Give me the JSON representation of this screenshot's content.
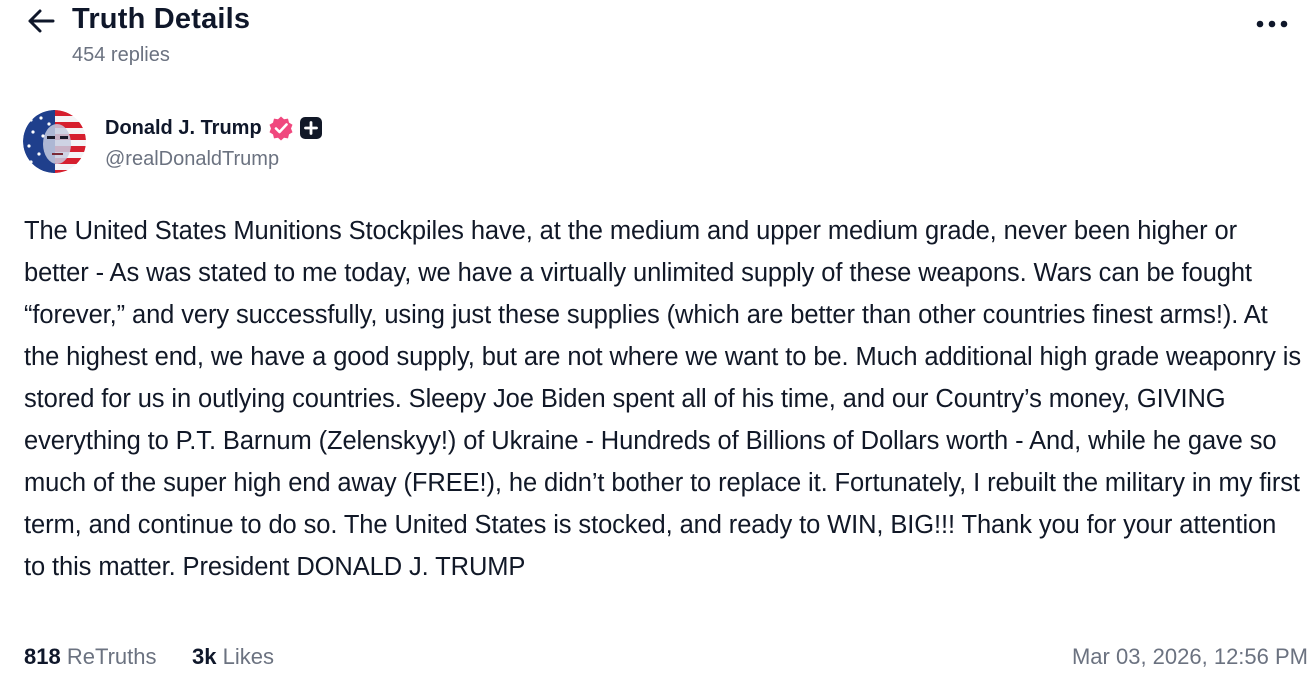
{
  "header": {
    "title": "Truth Details",
    "replies": "454 replies",
    "back_icon": "arrow-left-icon",
    "more_icon": "more-horizontal-icon"
  },
  "author": {
    "name": "Donald J. Trump",
    "handle": "@realDonaldTrump",
    "verified_icon": "verified-badge-icon",
    "plus_icon": "plus-badge-icon",
    "verified_color": "#f0487e"
  },
  "post": {
    "text": "The United States Munitions Stockpiles have, at the medium and upper medium grade, never been higher or better - As was stated to me today, we have a virtually unlimited supply of these weapons. Wars can be fought “forever,” and very successfully, using just these supplies (which are better than other countries finest arms!). At the highest end, we have a good supply, but are not where we want to be. Much additional high grade weaponry is stored for us in outlying countries. Sleepy Joe Biden spent all of his time, and our Country’s money, GIVING everything to P.T. Barnum (Zelenskyy!) of Ukraine - Hundreds of Billions of Dollars worth - And, while he gave so much of the super high end away (FREE!), he didn’t bother to replace it. Fortunately, I rebuilt the military in my first term, and continue to do so. The United States is stocked, and ready to WIN, BIG!!! Thank you for your attention to this matter. President DONALD J. TRUMP"
  },
  "stats": {
    "retruths_count": "818",
    "retruths_label": "ReTruths",
    "likes_count": "3k",
    "likes_label": "Likes",
    "timestamp": "Mar 03, 2026, 12:56 PM"
  }
}
